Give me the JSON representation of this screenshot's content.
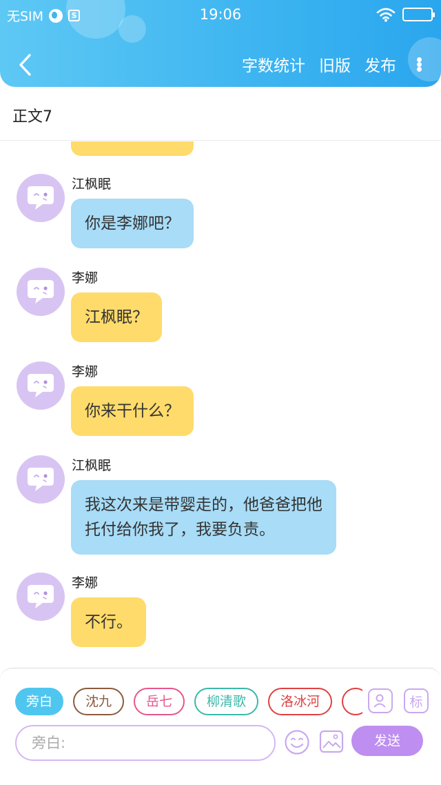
{
  "status_bar": {
    "carrier": "无SIM",
    "time": "19:06",
    "sq_icon_label": "S"
  },
  "nav": {
    "word_count": "字数统计",
    "old_version": "旧版",
    "publish": "发布"
  },
  "title": "正文7",
  "messages": [
    {
      "name": "江枫眠",
      "text": "你是李娜吧？",
      "color": "blue"
    },
    {
      "name": "李娜",
      "text": "江枫眠？",
      "color": "yellow"
    },
    {
      "name": "李娜",
      "text": "你来干什么？",
      "color": "yellow"
    },
    {
      "name": "江枫眠",
      "lines": [
        "我这次来是带婴走的，他爸爸把他",
        "托付给你我了，我要负责。"
      ],
      "color": "blue"
    },
    {
      "name": "李娜",
      "text": "不行。",
      "color": "yellow"
    }
  ],
  "characters": [
    "旁白",
    "沈九",
    "岳七",
    "柳清歌",
    "洛冰河"
  ],
  "character_colors": {
    "沈九": "#8b5a3c",
    "岳七": "#e6558b",
    "柳清歌": "#3ab8a8",
    "洛冰河": "#e04040"
  },
  "tag_icon_label": "标",
  "input": {
    "placeholder": "旁白:"
  },
  "send_label": "发送",
  "colors": {
    "header": "#3fb6f1",
    "blue_bubble": "#a8dcf7",
    "yellow_bubble": "#ffdb6b",
    "avatar": "#d8c4f3",
    "accent_purple": "#be8ef0"
  }
}
